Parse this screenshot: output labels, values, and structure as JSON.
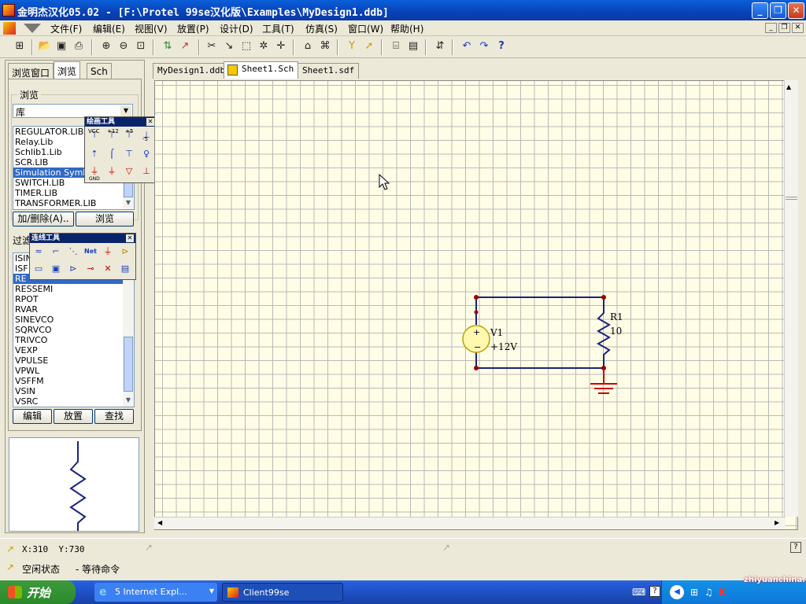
{
  "window": {
    "title": "金明杰汉化05.02 - [F:\\Protel 99se汉化版\\Examples\\MyDesign1.ddb]"
  },
  "menu": [
    "文件(F)",
    "编辑(E)",
    "视图(V)",
    "放置(P)",
    "设计(D)",
    "工具(T)",
    "仿真(S)",
    "窗口(W)",
    "帮助(H)"
  ],
  "left_tabs": [
    "浏览窗口",
    "浏览",
    "Sch"
  ],
  "browse": {
    "group_label": "浏览",
    "combo_value": "库",
    "libraries": [
      "REGULATOR.LIB",
      "Relay.Lib",
      "Schlib1.Lib",
      "SCR.LIB",
      "Simulation Symbol",
      "SWITCH.LIB",
      "TIMER.LIB",
      "TRANSFORMER.LIB"
    ],
    "selected_library": "Simulation Symbol",
    "add_remove_button": "加/删除(A)..",
    "browse_button": "浏览"
  },
  "filter": {
    "label": "过滤",
    "components": [
      "ISIN",
      "ISF",
      "RE",
      "RESSEMI",
      "RPOT",
      "RVAR",
      "SINEVCO",
      "SQRVCO",
      "TRIVCO",
      "VEXP",
      "VPULSE",
      "VPWL",
      "VSFFM",
      "VSIN",
      "VSRC"
    ],
    "selected_component": "RE",
    "edit_button": "编辑",
    "place_button": "放置",
    "find_button": "查找"
  },
  "power_palette": {
    "title": "绘画工具",
    "labels": [
      "VCC",
      "+12",
      "+5",
      "-5",
      "GND"
    ]
  },
  "wiring_palette": {
    "title": "连线工具"
  },
  "doc_tabs": [
    "MyDesign1.ddb",
    "Sheet1.Sch",
    "Sheet1.sdf"
  ],
  "active_doc_tab": "Sheet1.Sch",
  "schematic": {
    "source": {
      "designator": "V1",
      "value": "+12V"
    },
    "resistor": {
      "designator": "R1",
      "value": "10"
    },
    "wire_color": "#1a237e",
    "ground_color": "#cc0000",
    "node_color": "#990000"
  },
  "status": {
    "coords": "X:310  Y:730",
    "state": "空闲状态",
    "command": "- 等待命令"
  },
  "taskbar": {
    "start_label": "开始",
    "tasks": [
      "5 Internet Expl...",
      "Client99se"
    ],
    "watermark": "zhiyuanchina.com"
  }
}
